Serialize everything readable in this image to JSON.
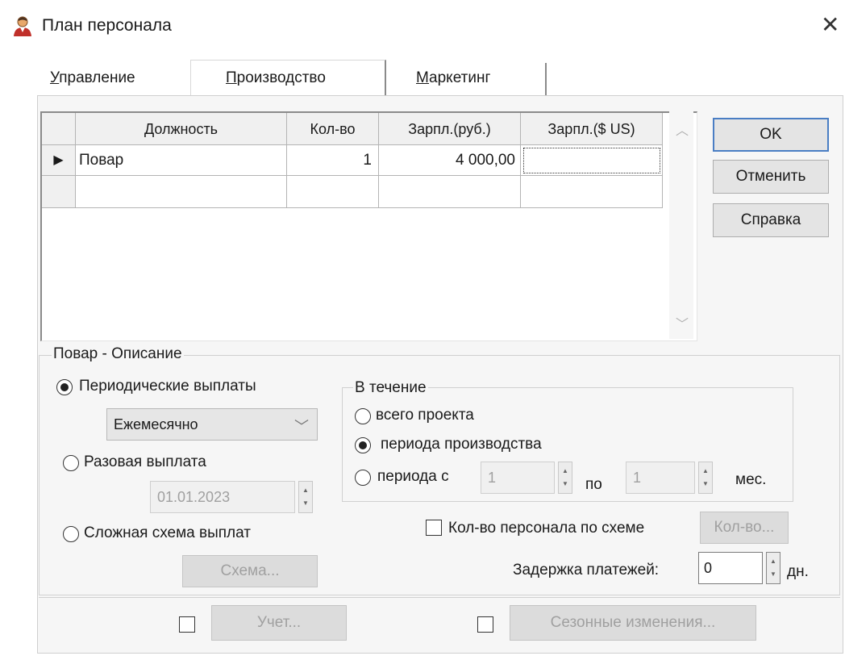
{
  "window": {
    "title": "План персонала",
    "close_glyph": "✕"
  },
  "tabs": [
    {
      "label": "Управление",
      "accel": "У",
      "rest": "правление"
    },
    {
      "label": "Производство",
      "accel": "П",
      "rest": "роизводство",
      "selected": true
    },
    {
      "label": "Маркетинг",
      "accel": "М",
      "rest": "аркетинг"
    }
  ],
  "grid": {
    "columns": [
      "Должность",
      "Кол-во",
      "Зарпл.(руб.)",
      "Зарпл.($ US)"
    ],
    "rows": [
      {
        "indicator": "▶",
        "position": "Повар",
        "count": "1",
        "salary_rub": "4 000,00",
        "salary_usd": ""
      }
    ]
  },
  "buttons": {
    "ok": "OK",
    "cancel": "Отменить",
    "help": "Справка"
  },
  "description": {
    "title": "Повар - Описание",
    "periodic": "Периодические выплаты",
    "frequency": "Ежемесячно",
    "one_time": "Разовая выплата",
    "one_time_date": "01.01.2023",
    "complex": "Сложная схема выплат",
    "scheme_button": "Схема...",
    "during": {
      "title": "В течение",
      "whole_project": "всего проекта",
      "production_period": "периода производства",
      "period_from": "периода с",
      "from_value": "1",
      "to_label": "по",
      "to_value": "1",
      "unit": "мес."
    },
    "staff_by_scheme": "Кол-во персонала по схеме",
    "count_button": "Кол-во...",
    "delay_label": "Задержка платежей:",
    "delay_value": "0",
    "delay_unit": "дн.",
    "accounting_button": "Учет...",
    "seasonal_button": "Сезонные изменения..."
  },
  "colors": {
    "accent_border": "#4a7ec4",
    "panel_bg": "#f6f6f6",
    "disabled_text": "#a0a0a0"
  },
  "icons": {
    "app": "person-icon"
  }
}
